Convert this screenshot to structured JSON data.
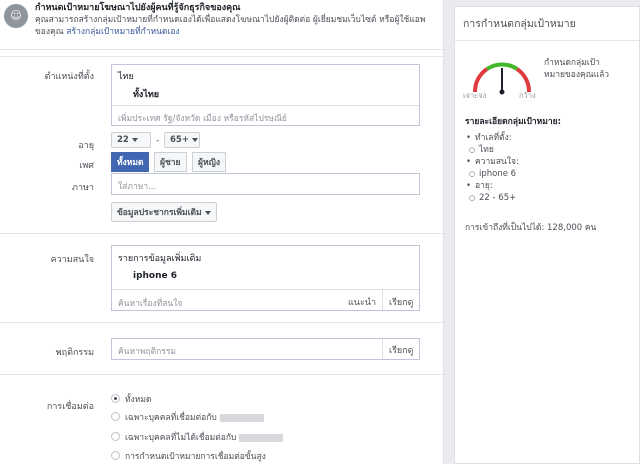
{
  "banner": {
    "title": "กำหนดเป้าหมายโฆษณาไปยังผู้คนที่รู้จักธุรกิจของคุณ",
    "text": "คุณสามารถสร้างกลุ่มเป้าหมายที่กำหนดเองได้เพื่อแสดงโฆษณาไปยังผู้ติดต่อ ผู้เยี่ยมชมเว็บไซต์ หรือผู้ใช้แอพของคุณ",
    "link": "สร้างกลุ่มเป้าหมายที่กำหนดเอง"
  },
  "location": {
    "label": "ตำแหน่งที่ตั้ง",
    "country": "ไทย",
    "scope": "ทั้งไทย",
    "placeholder": "เพิ่มประเทศ รัฐ/จังหวัด เมือง หรือรหัสไปรษณีย์"
  },
  "age": {
    "label": "อายุ",
    "min": "22",
    "dash": "-",
    "max": "65+"
  },
  "gender": {
    "label": "เพศ",
    "options": [
      "ทั้งหมด",
      "ผู้ชาย",
      "ผู้หญิง"
    ],
    "selected": "ทั้งหมด"
  },
  "language": {
    "label": "ภาษา",
    "placeholder": "ใส่ภาษา..."
  },
  "more_demographics": "ข้อมูลประชากรเพิ่มเติม",
  "interests": {
    "label": "ความสนใจ",
    "header": "รายการข้อมูลเพิ่มเติม",
    "item": "iphone 6",
    "placeholder": "ค้นหาเรื่องที่สนใจ",
    "suggest": "แนะนำ",
    "browse": "เรียกดู"
  },
  "behaviors": {
    "label": "พฤติกรรม",
    "placeholder": "ค้นหาพฤติกรรม",
    "browse": "เรียกดู"
  },
  "connections": {
    "label": "การเชื่อมต่อ",
    "options": [
      "ทั้งหมด",
      "เฉพาะบุคคลที่เชื่อมต่อกับ",
      "เฉพาะบุคคลที่ไม่ได้เชื่อมต่อกับ",
      "การกำหนดเป้าหมายการเชื่อมต่อขั้นสูง"
    ],
    "selected_index": 0
  },
  "sidebar": {
    "title": "การกำหนดกลุ่มเป้าหมาย",
    "gauge_left": "เจาะจง",
    "gauge_right": "กว้าง",
    "description": "กำหนดกลุ่มเป้าหมายของคุณแล้ว",
    "summary_title": "รายละเอียดกลุ่มเป้าหมาย:",
    "loc_label": "ทำเลที่ตั้ง:",
    "loc_value": "ไทย",
    "interest_label": "ความสนใจ:",
    "interest_value": "iphone 6",
    "age_label": "อายุ:",
    "age_value": "22 - 65+",
    "reach": "การเข้าถึงที่เป็นไปได้: 128,000 คน",
    "gauge_position": 0.5
  }
}
